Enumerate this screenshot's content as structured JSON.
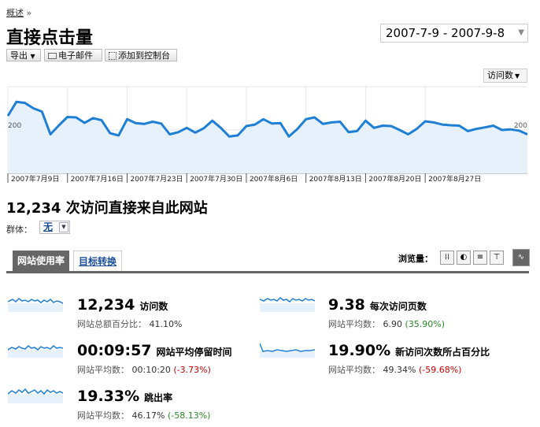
{
  "breadcrumb": {
    "label": "概述",
    "sep": "»"
  },
  "page": {
    "title": "直接点击量",
    "date_range": "2007-7-9 - 2007-9-8"
  },
  "toolbar": {
    "export": "导出",
    "email": "电子邮件",
    "dashboard": "添加到控制台"
  },
  "graph": {
    "metric_select": "访问数"
  },
  "chart_data": {
    "type": "area",
    "title": "",
    "ylim": [
      0,
      400
    ],
    "y_ticks": [
      200,
      400
    ],
    "x_tick_labels": [
      "2007年7月9日",
      "2007年7月16日",
      "2007年7月23日",
      "2007年7月30日",
      "2007年8月6日",
      "2007年8月13日",
      "2007年8月20日",
      "2007年8月27日"
    ],
    "series": [
      {
        "values": [
          265,
          330,
          325,
          300,
          285,
          180,
          222,
          260,
          258,
          233,
          255,
          245,
          185,
          175,
          250,
          232,
          228,
          238,
          230,
          180,
          190,
          210,
          188,
          208,
          243,
          210,
          170,
          175,
          218,
          225,
          250,
          230,
          232,
          170,
          205,
          250,
          258,
          228,
          235,
          238,
          190,
          195,
          243,
          210,
          220,
          218,
          200,
          180,
          205,
          240,
          235,
          225,
          222,
          220,
          195,
          205,
          212,
          220,
          200,
          203,
          197,
          180
        ]
      }
    ],
    "line_color": "#1f7fd4",
    "fill_color": "#e6f1fb",
    "grid": true
  },
  "headline": "12,234 次访问直接来自此网站",
  "segment": {
    "label": "群体：",
    "value": "无"
  },
  "tabs": [
    "网站使用率",
    "目标转换"
  ],
  "view": {
    "label": "浏览量："
  },
  "metrics": [
    {
      "value": "12,234",
      "label": "访问数",
      "sub_label": "网站总额百分比：",
      "sub_value": "41.10%",
      "delta": ""
    },
    {
      "value": "9.38",
      "label": "每次访问页数",
      "sub_label": "网站平均数：",
      "sub_value": "6.90",
      "delta": "(35.90%)"
    },
    {
      "value": "00:09:57",
      "label": "网站平均停留时间",
      "sub_label": "网站平均数：",
      "sub_value": "00:10:20",
      "delta": "(-3.73%)"
    },
    {
      "value": "19.90%",
      "label": "新访问次数所占百分比",
      "sub_label": "网站平均数：",
      "sub_value": "49.34%",
      "delta": "(-59.68%)"
    },
    {
      "value": "19.33%",
      "label": "跳出率",
      "sub_label": "网站平均数：",
      "sub_value": "46.17%",
      "delta": "(-58.13%)"
    }
  ]
}
